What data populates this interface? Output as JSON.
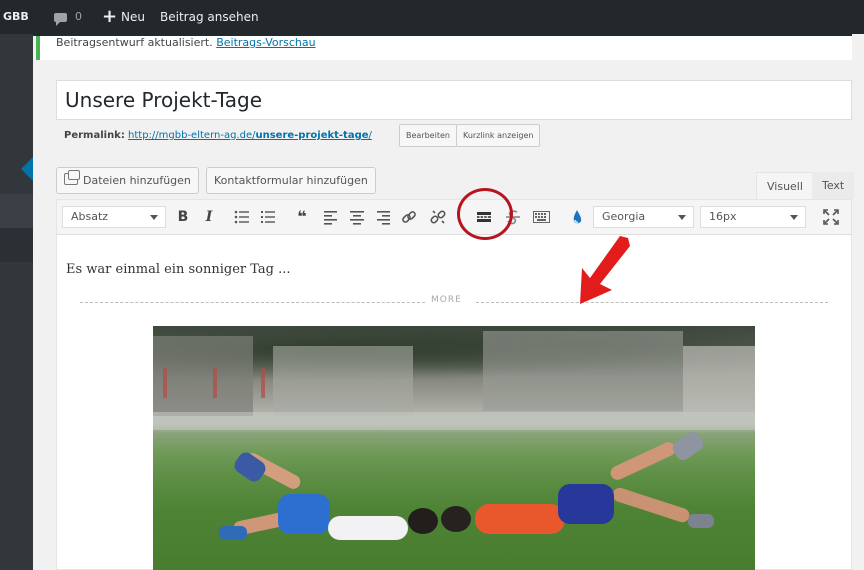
{
  "adminbar": {
    "site": "GBB",
    "comments_count": "0",
    "new_label": "Neu",
    "view_post_label": "Beitrag ansehen"
  },
  "notice": {
    "text": "Beitragsentwurf aktualisiert.",
    "link": "Beitrags-Vorschau"
  },
  "post": {
    "title": "Unsere Projekt-Tage",
    "permalink_label": "Permalink:",
    "permalink_base": "http://mgbb-eltern-ag.de/",
    "permalink_slug": "unsere-projekt-tage",
    "permalink_end": "/",
    "edit_label": "Bearbeiten",
    "shortlink_label": "Kurzlink anzeigen"
  },
  "media": {
    "add_files_label": "Dateien hinzufügen",
    "contact_form_label": "Kontaktformular hinzufügen"
  },
  "tabs": {
    "visual": "Visuell",
    "text": "Text"
  },
  "toolbar": {
    "format": "Absatz",
    "font": "Georgia",
    "size": "16px",
    "bold": "B",
    "italic": "I",
    "quote": "❝"
  },
  "editor": {
    "paragraph": "Es war einmal ein sonniger Tag ...",
    "more_label": "MORE"
  },
  "colors": {
    "admin_bg": "#23282d",
    "accent": "#0073aa",
    "success": "#46b450",
    "annotation": "#b8141f"
  }
}
